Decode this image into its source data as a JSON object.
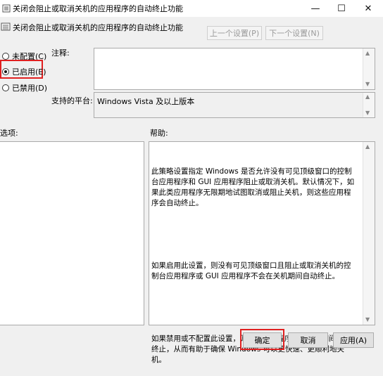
{
  "window": {
    "title": "关闭会阻止或取消关机的应用程序的自动终止功能",
    "minimize_glyph": "—",
    "maximize_glyph": "☐",
    "close_glyph": "✕"
  },
  "header": {
    "title": "关闭会阻止或取消关机的应用程序的自动终止功能",
    "prev_setting": "上一个设置(P)",
    "next_setting": "下一个设置(N)"
  },
  "options": {
    "not_configured": "未配置(C)",
    "enabled": "已启用(E)",
    "disabled": "已禁用(D)",
    "selected": "enabled"
  },
  "comment": {
    "label": "注释:",
    "value": ""
  },
  "platform": {
    "label": "支持的平台:",
    "value": "Windows Vista 及以上版本"
  },
  "options_label": "选项:",
  "help": {
    "label": "帮助:",
    "paragraph1": "此策略设置指定 Windows 是否允许没有可见顶级窗口的控制台应用程序和 GUI 应用程序阻止或取消关机。默认情况下，如果此类应用程序无限期地试图取消或阻止关机，则这些应用程序会自动终止。",
    "paragraph2": "如果启用此设置，则没有可见顶级窗口且阻止或取消关机的控制台应用程序或 GUI 应用程序不会在关机期间自动终止。",
    "paragraph3": "如果禁用或不配置此设置，则这些应用程序将在关机期间自动终止，从而有助于确保 Windows 可以更快速、更顺利地关机。"
  },
  "buttons": {
    "ok": "确定",
    "cancel": "取消",
    "apply": "应用(A)"
  },
  "colors": {
    "highlight_border": "#e02020",
    "window_bg": "#f0f0f0"
  },
  "icons": [
    "policy-icon",
    "minimize-icon",
    "maximize-icon",
    "close-icon",
    "scroll-up-icon",
    "scroll-down-icon"
  ]
}
